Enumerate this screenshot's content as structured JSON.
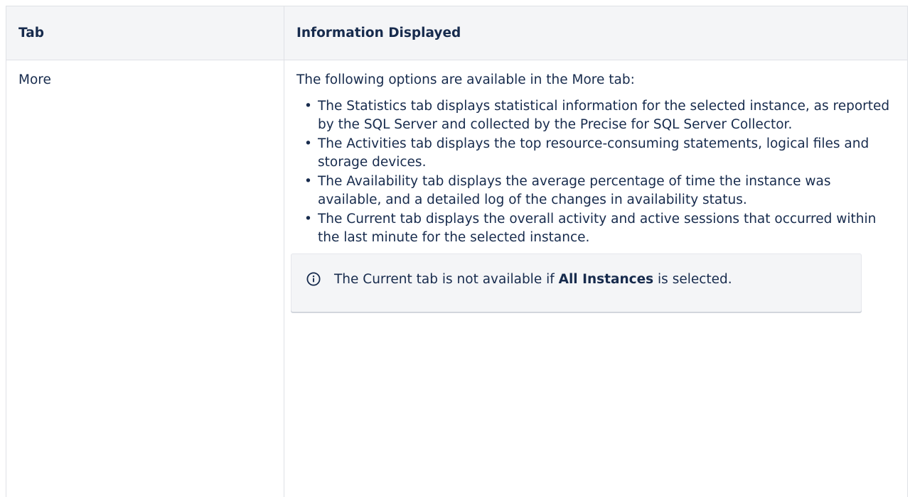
{
  "table": {
    "headers": [
      "Tab",
      "Information Displayed"
    ],
    "row": {
      "tab_name": "More",
      "intro": "The following options are available in the More tab:",
      "items": [
        "The Statistics tab displays statistical information for the selected instance, as reported by the SQL Server and collected by the Precise for SQL Server Collector.",
        "The Activities tab displays the top resource-consuming statements, logical files and storage devices.",
        "The Availability tab displays the average percentage of time the instance was available, and a detailed log of the changes in availability status.",
        "The Current tab displays the overall activity and active sessions that occurred within the last minute for the selected instance."
      ],
      "note": {
        "icon": "info-icon",
        "text_before": "The Current tab is not available if ",
        "bold": "All Instances",
        "text_after": " is selected."
      }
    }
  },
  "colors": {
    "text": "#172b4d",
    "header_bg": "#f4f5f7",
    "border": "#dfe1e6",
    "note_bg": "#f4f5f7"
  }
}
